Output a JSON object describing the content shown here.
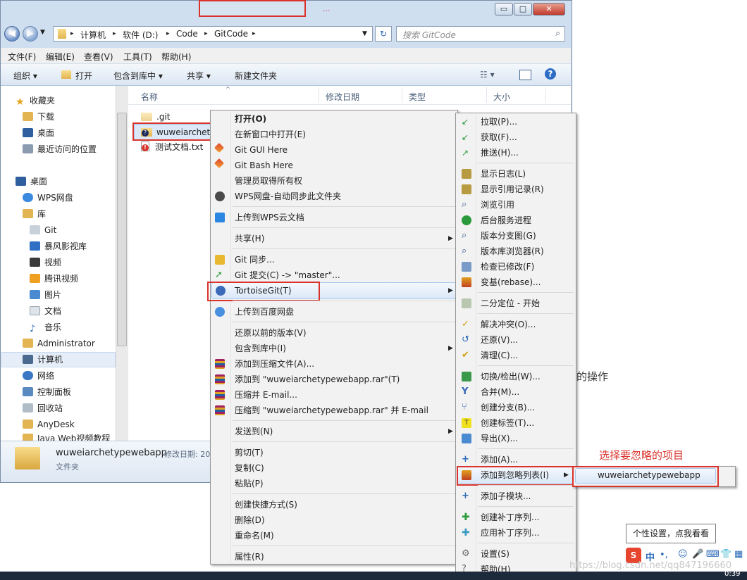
{
  "colors": {
    "accent_red": "#d9332c",
    "window_frame": "#cfdff0",
    "menu_bg": "#f2f2f2",
    "highlight": "#dbe8f8"
  },
  "window": {
    "buttons": {
      "minimize": "▭",
      "maximize": "□",
      "close": "✕"
    },
    "background_tab_text": "...",
    "background_tab_text2": "...",
    "address": {
      "root_arrow": "▸",
      "parts": [
        "计算机",
        "软件 (D:)",
        "Code",
        "GitCode"
      ],
      "separator": "▸"
    },
    "search_placeholder": "搜索 GitCode",
    "menubar": [
      "文件(F)",
      "编辑(E)",
      "查看(V)",
      "工具(T)",
      "帮助(H)"
    ],
    "toolbar": [
      "组织 ▾",
      "打开",
      "包含到库中 ▾",
      "共享 ▾",
      "新建文件夹"
    ]
  },
  "nav": {
    "favorites_header": "收藏夹",
    "favorites": [
      "下载",
      "桌面",
      "最近访问的位置"
    ],
    "desktop": "桌面",
    "items": [
      "WPS网盘",
      "库",
      "Git",
      "暴风影视库",
      "视频",
      "腾讯视频",
      "图片",
      "文档",
      "音乐",
      "Administrator",
      "计算机",
      "网络",
      "控制面板",
      "回收站",
      "AnyDesk",
      "Java Web视频教程"
    ]
  },
  "columns": [
    "名称",
    "修改日期",
    "类型",
    "大小"
  ],
  "files": [
    ".git",
    "wuweiarchety",
    "测试文档.txt"
  ],
  "details": {
    "name": "wuweiarchetypewebapp",
    "date_label": "修改日期: 20",
    "type": "文件夹"
  },
  "context_menu": {
    "items": [
      "打开(O)",
      "在新窗口中打开(E)",
      "Git GUI Here",
      "Git Bash Here",
      "管理员取得所有权",
      "WPS网盘-自动同步此文件夹",
      "上传到WPS云文档",
      "共享(H)",
      "Git 同步...",
      "Git 提交(C) -> \"master\"...",
      "TortoiseGit(T)",
      "上传到百度网盘",
      "还原以前的版本(V)",
      "包含到库中(I)",
      "添加到压缩文件(A)...",
      "添加到 \"wuweiarchetypewebapp.rar\"(T)",
      "压缩并 E-mail...",
      "压缩到 \"wuweiarchetypewebapp.rar\" 并 E-mail",
      "发送到(N)",
      "剪切(T)",
      "复制(C)",
      "粘贴(P)",
      "创建快捷方式(S)",
      "删除(D)",
      "重命名(M)",
      "属性(R)"
    ]
  },
  "tortoise_menu": {
    "items": [
      "拉取(P)...",
      "获取(F)...",
      "推送(H)...",
      "显示日志(L)",
      "显示引用记录(R)",
      "浏览引用",
      "后台服务进程",
      "版本分支图(G)",
      "版本库浏览器(R)",
      "检查已修改(F)",
      "变基(rebase)...",
      "二分定位 - 开始",
      "解决冲突(O)...",
      "还原(V)...",
      "清理(C)...",
      "切换/检出(W)...",
      "合并(M)...",
      "创建分支(B)...",
      "创建标签(T)...",
      "导出(X)...",
      "添加(A)...",
      "添加到忽略列表(I)",
      "添加子模块...",
      "创建补丁序列...",
      "应用补丁序列...",
      "设置(S)",
      "帮助(H)"
    ]
  },
  "ignore_submenu": {
    "item": "wuweiarchetypewebapp"
  },
  "annotation": "选择要忽略的项目",
  "bg_text": "的操作",
  "tooltip": "个性设置，点我看看",
  "ime": {
    "logo": "S",
    "mode": "中",
    "punct": "•,",
    "icons": [
      "☺",
      "🎤",
      "⌨",
      "👕",
      "▦"
    ]
  },
  "watermark": "https://blog.csdn.net/qq847196660",
  "clock": "0:39"
}
